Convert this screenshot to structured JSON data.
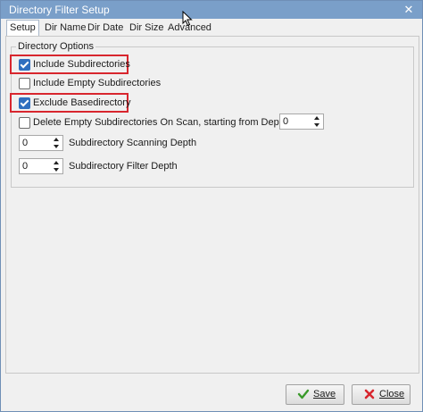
{
  "window": {
    "title": "Directory Filter Setup"
  },
  "tabs": [
    {
      "label": "Setup"
    },
    {
      "label": "Dir Name"
    },
    {
      "label": "Dir Date"
    },
    {
      "label": "Dir Size"
    },
    {
      "label": "Advanced"
    }
  ],
  "group": {
    "title": "Directory Options"
  },
  "options": [
    {
      "label": "Include Subdirectories",
      "checked": true
    },
    {
      "label": "Include Empty Subdirectories",
      "checked": false
    },
    {
      "label": "Exclude Basedirectory",
      "checked": true
    },
    {
      "label": "Delete Empty Subdirectories On Scan, starting from Depth",
      "checked": false
    }
  ],
  "spinners": {
    "delete_depth": "0",
    "scanning_depth": "0",
    "scanning_depth_label": "Subdirectory Scanning Depth",
    "filter_depth": "0",
    "filter_depth_label": "Subdirectory Filter Depth"
  },
  "buttons": {
    "save": "Save",
    "close": "Close"
  },
  "colors": {
    "titlebar": "#7a9fc9",
    "highlight": "#d8262e",
    "checkbox": "#2f6fbf"
  }
}
